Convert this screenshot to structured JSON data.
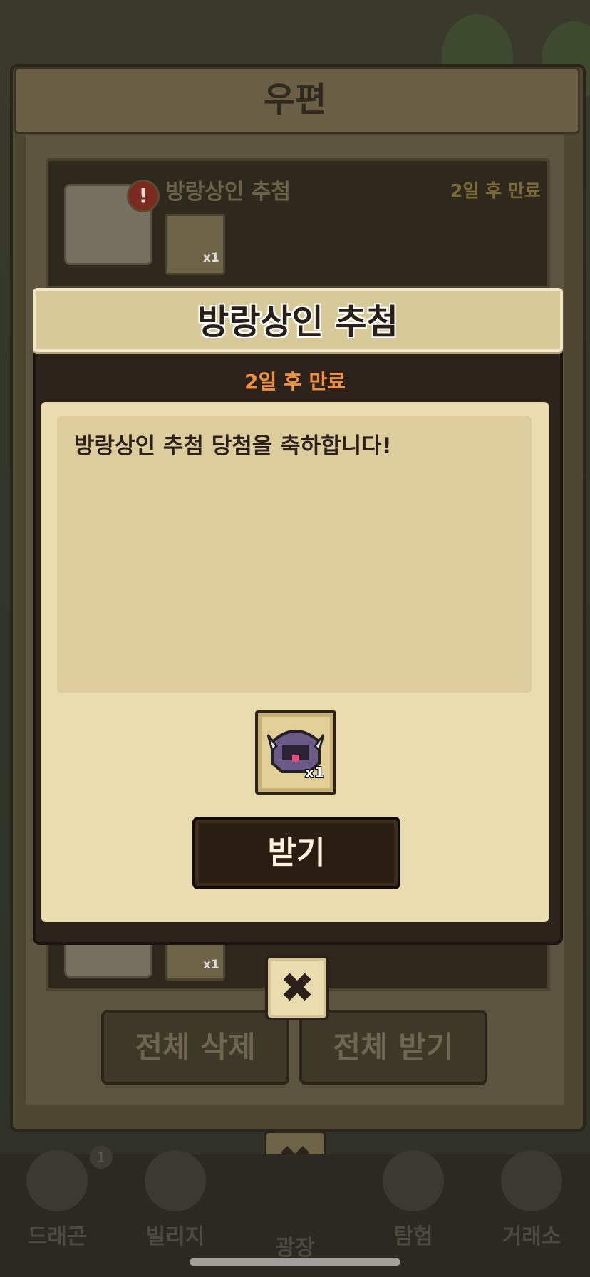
{
  "background_window": {
    "title": "우편",
    "item": {
      "title": "방랑상인 추첨",
      "expiry": "2일 후 만료",
      "reward_count": "x1"
    },
    "item2": {
      "reward_count": "x1"
    },
    "buttons": {
      "delete_all": "전체 삭제",
      "claim_all": "전체 받기"
    }
  },
  "nav": {
    "items": [
      {
        "label": "드래곤",
        "icon": "dragon-icon",
        "badge": "1"
      },
      {
        "label": "빌리지",
        "icon": "village-icon"
      },
      {
        "label": "광장",
        "icon": "plaza-icon"
      },
      {
        "label": "탐험",
        "icon": "compass-icon"
      },
      {
        "label": "거래소",
        "icon": "exchange-icon"
      }
    ]
  },
  "dialog": {
    "title": "방랑상인 추첨",
    "expiry": "2일 후 만료",
    "message": "방랑상인 추첨 당첨을 축하합니다!",
    "reward": {
      "icon": "helmet-icon",
      "count": "x1"
    },
    "claim_label": "받기",
    "close_icon": "close-icon"
  },
  "colors": {
    "dialog_header": "#d8c999",
    "dialog_panel": "#e9ddb0",
    "expiry_accent": "#f0903e",
    "button_dark": "#2a1e13"
  }
}
